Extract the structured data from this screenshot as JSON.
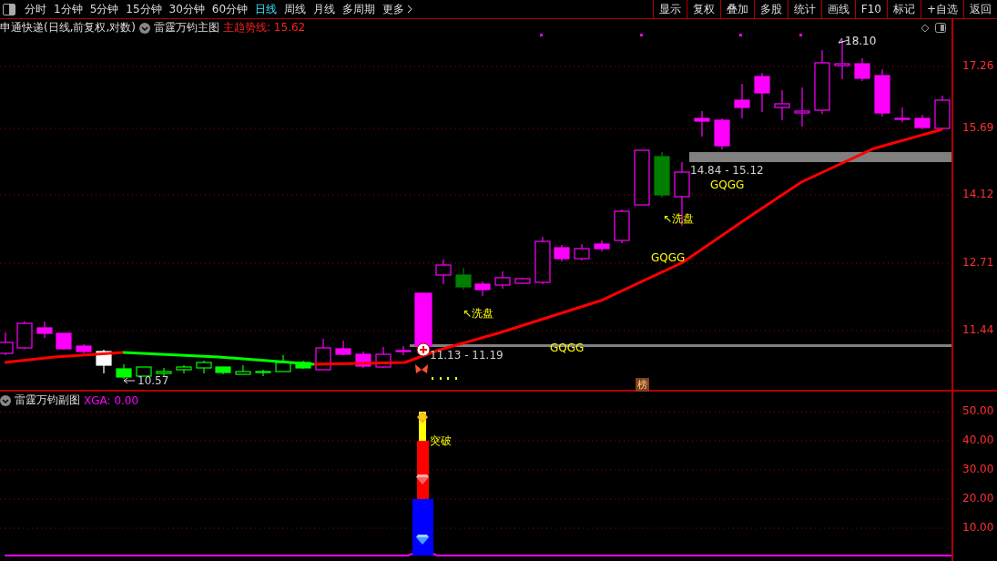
{
  "toolbar": {
    "period_tabs": [
      {
        "label": "分时",
        "selected": false
      },
      {
        "label": "1分钟",
        "selected": false
      },
      {
        "label": "5分钟",
        "selected": false
      },
      {
        "label": "15分钟",
        "selected": false
      },
      {
        "label": "30分钟",
        "selected": false
      },
      {
        "label": "60分钟",
        "selected": false
      },
      {
        "label": "日线",
        "selected": true
      },
      {
        "label": "周线",
        "selected": false
      },
      {
        "label": "月线",
        "selected": false
      },
      {
        "label": "多周期",
        "selected": false
      },
      {
        "label": "更多",
        "selected": false
      }
    ],
    "buttons": [
      "显示",
      "复权",
      "叠加",
      "多股",
      "统计",
      "画线",
      "F10",
      "标记",
      "+自选",
      "返回"
    ]
  },
  "main_chart": {
    "stock": "申通快递(日线,前复权,对数)",
    "indicator": "雷霆万钧主图",
    "line_label": "主趋势线: 15.62",
    "annotations": [
      {
        "kind": "high",
        "text": "18.10"
      },
      {
        "kind": "range",
        "text": "14.84 - 15.12"
      },
      {
        "kind": "signal",
        "text": "GQGG"
      },
      {
        "kind": "wash",
        "text": "↖洗盘"
      },
      {
        "kind": "signal",
        "text": "GQGG"
      },
      {
        "kind": "wash",
        "text": "↖洗盘"
      },
      {
        "kind": "signal",
        "text": "GQGG"
      },
      {
        "kind": "range",
        "text": "11.13 - 11.19"
      },
      {
        "kind": "low",
        "text": "10.57"
      },
      {
        "kind": "badge",
        "text": "榜"
      }
    ],
    "y_ticks": [
      "17.26",
      "15.69",
      "14.12",
      "12.71",
      "11.44"
    ]
  },
  "sub_chart": {
    "indicator": "雷霆万钧副图",
    "value_label": "XGA: 0.00",
    "signal": "突破",
    "y_ticks": [
      "50.00",
      "40.00",
      "30.00",
      "20.00",
      "10.00"
    ]
  }
}
